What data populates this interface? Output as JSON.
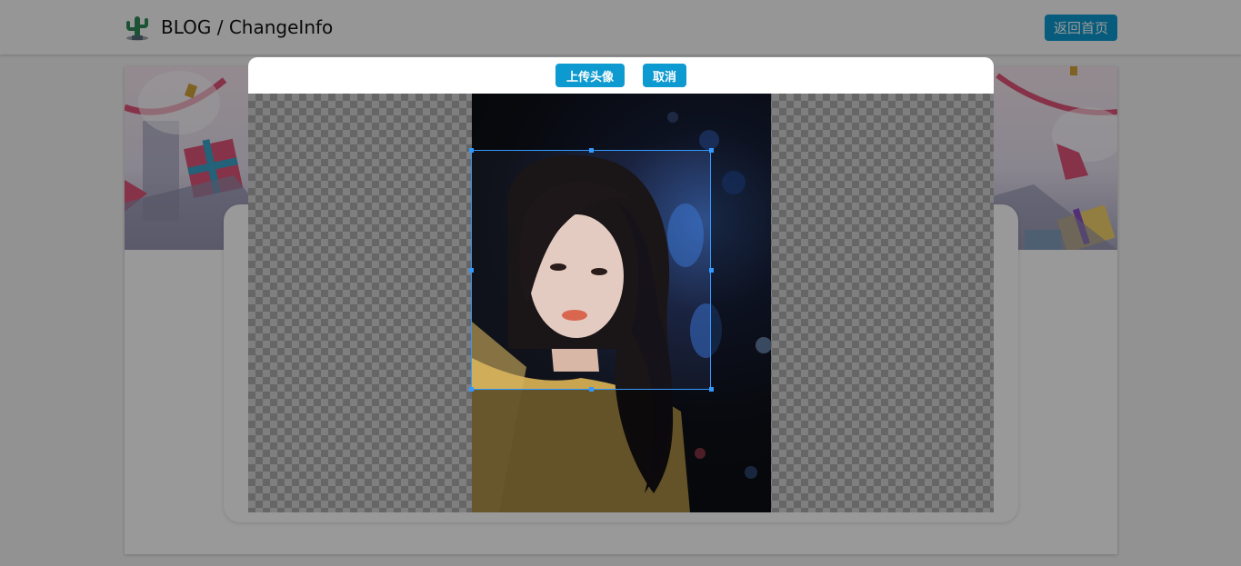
{
  "header": {
    "title": "BLOG / ChangeInfo",
    "home_button": "返回首页",
    "logo_icon": "cactus-icon"
  },
  "modal": {
    "upload_button": "上传头像",
    "cancel_button": "取消"
  },
  "colors": {
    "accent": "#0d9ad0",
    "crop_border": "#3399ff"
  }
}
